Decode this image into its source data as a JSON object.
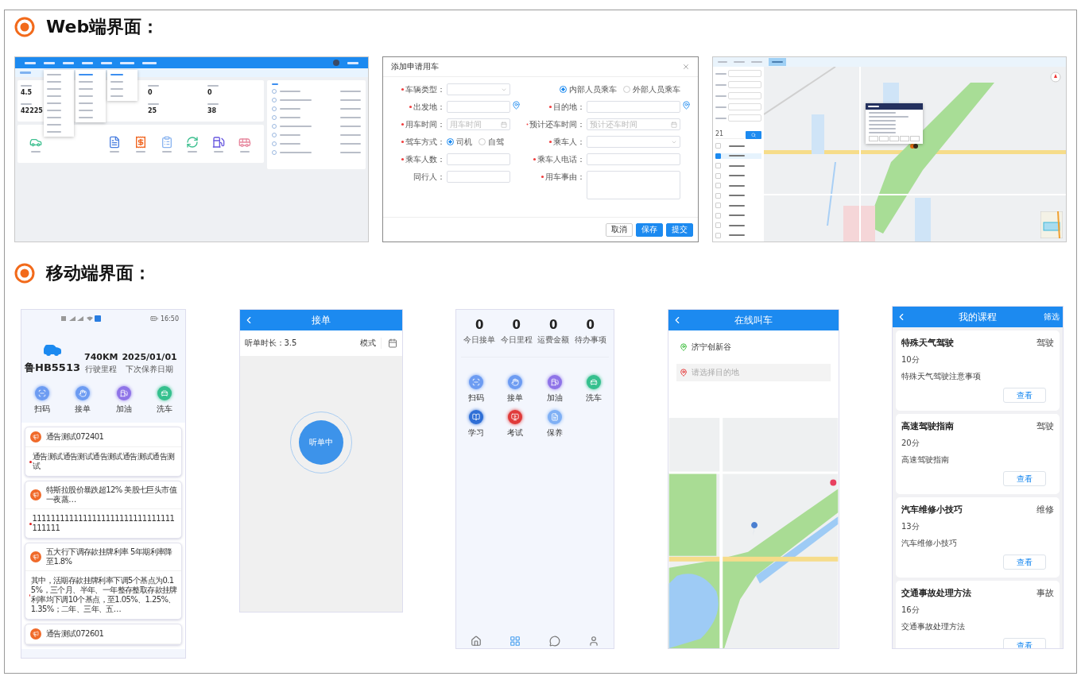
{
  "web_section": {
    "title": "Web端界面：",
    "dashboard": {
      "stats": [
        {
          "value": "4.5"
        },
        {
          "value": "0"
        },
        {
          "value": "0"
        },
        {
          "value": "42225"
        },
        {
          "value": "25"
        },
        {
          "value": "38"
        }
      ],
      "shortcuts": [
        {
          "kind": "car",
          "color": "#3cbf8f"
        },
        {
          "kind": "doc",
          "color": "#4a7fe0"
        },
        {
          "kind": "invoice",
          "color": "#f0641e"
        },
        {
          "kind": "clipboard",
          "color": "#8ab4f0"
        },
        {
          "kind": "refresh",
          "color": "#3cbf8f"
        },
        {
          "kind": "fuel",
          "color": "#6a5ae0"
        },
        {
          "kind": "bus",
          "color": "#e88aa0"
        }
      ]
    },
    "dialog": {
      "title": "添加申请用车",
      "fields": [
        {
          "kind": "select",
          "label": "车辆类型：",
          "required": true
        },
        {
          "kind": "radio",
          "options": [
            {
              "label": "内部人员乘车",
              "selected": true
            },
            {
              "label": "外部人员乘车",
              "selected": false
            }
          ]
        },
        {
          "kind": "location",
          "label": "出发地：",
          "required": true
        },
        {
          "kind": "location",
          "label": "目的地：",
          "required": true
        },
        {
          "kind": "date",
          "label": "用车时间：",
          "required": true,
          "placeholder": "用车时间"
        },
        {
          "kind": "date",
          "label": "预计还车时间：",
          "required": true,
          "placeholder": "预计还车时间"
        },
        {
          "kind": "radio",
          "label": "驾车方式：",
          "required": true,
          "options": [
            {
              "label": "司机",
              "selected": true
            },
            {
              "label": "自驾",
              "selected": false
            }
          ]
        },
        {
          "kind": "select",
          "label": "乘车人：",
          "required": true
        },
        {
          "kind": "text",
          "label": "乘车人数：",
          "required": true
        },
        {
          "kind": "text",
          "label": "乘车人电话：",
          "required": true
        },
        {
          "kind": "text",
          "label": "同行人：",
          "required": false
        },
        {
          "kind": "textarea",
          "label": "用车事由：",
          "required": true
        }
      ],
      "buttons": [
        {
          "label": "取消",
          "kind": "plain"
        },
        {
          "label": "保存",
          "kind": "primary"
        },
        {
          "label": "提交",
          "kind": "primary"
        }
      ]
    },
    "map_view": {
      "search_value": "21",
      "vehicles": [
        {
          "checked": false
        },
        {
          "checked": true
        },
        {
          "checked": false
        },
        {
          "checked": false
        },
        {
          "checked": false
        },
        {
          "checked": false
        },
        {
          "checked": false
        },
        {
          "checked": false
        },
        {
          "checked": false
        },
        {
          "checked": false
        }
      ]
    }
  },
  "mobile_section": {
    "title": "移动端界面：",
    "home": {
      "time": "16:50",
      "plate": "鲁HB5513",
      "stats": [
        {
          "value": "740KM",
          "label": "行驶里程"
        },
        {
          "value": "2025/01/01",
          "label": "下次保养日期"
        }
      ],
      "actions": [
        {
          "kind": "scan",
          "label": "扫码",
          "color": "#6d9cf2"
        },
        {
          "kind": "hand",
          "label": "接单",
          "color": "#6d9cf2"
        },
        {
          "kind": "fuel",
          "label": "加油",
          "color": "#8f74e8"
        },
        {
          "kind": "wash",
          "label": "洗车",
          "color": "#35c08e"
        }
      ],
      "notices": [
        {
          "title": "通告测试072401",
          "body": "通告测试通告测试通告测试通告测试通告测试"
        },
        {
          "title": "特斯拉股价暴跌超12% 美股七巨头市值一夜蒸…",
          "body": "1111111111111111111111111111111111111"
        },
        {
          "title": "五大行下调存款挂牌利率 5年期利率降至1.8%",
          "body": "其中，活期存款挂牌利率下调5个基点为0.15%，三个月、半年、一年整存整取存款挂牌利率均下调10个基点，至1.05%、1.25%、1.35%；二年、三年、五…"
        },
        {
          "title": "通告测试072601"
        }
      ]
    },
    "order": {
      "title": "接单",
      "duration": "听单时长：3.5",
      "mode": "模式",
      "button": "听单中"
    },
    "workbench": {
      "stats": [
        {
          "value": "0",
          "label": "今日接单"
        },
        {
          "value": "0",
          "label": "今日里程"
        },
        {
          "value": "0",
          "label": "运费金额"
        },
        {
          "value": "0",
          "label": "待办事项"
        }
      ],
      "actions": [
        {
          "kind": "scan",
          "label": "扫码",
          "color": "#6d9cf2"
        },
        {
          "kind": "hand",
          "label": "接单",
          "color": "#6d9cf2"
        },
        {
          "kind": "fuel",
          "label": "加油",
          "color": "#8f74e8"
        },
        {
          "kind": "wash",
          "label": "洗车",
          "color": "#35c08e"
        },
        {
          "kind": "book",
          "label": "学习",
          "color": "#2f6fd6"
        },
        {
          "kind": "exam",
          "label": "考试",
          "color": "#e03a3a"
        },
        {
          "kind": "doc",
          "label": "保养",
          "color": "#7fb0f5"
        }
      ],
      "tabs": [
        {
          "kind": "home",
          "selected": false
        },
        {
          "kind": "grid",
          "selected": true
        },
        {
          "kind": "chat",
          "selected": false
        },
        {
          "kind": "user",
          "selected": false
        }
      ]
    },
    "ride": {
      "title": "在线叫车",
      "origin": "济宁创新谷",
      "destination_placeholder": "请选择目的地"
    },
    "courses": {
      "title": "我的课程",
      "filter": "筛选",
      "items": [
        {
          "title": "特殊天气驾驶",
          "category": "驾驶",
          "duration": "10分",
          "description": "特殊天气驾驶注意事项",
          "action": "查看"
        },
        {
          "title": "高速驾驶指南",
          "category": "驾驶",
          "duration": "20分",
          "description": "高速驾驶指南",
          "action": "查看"
        },
        {
          "title": "汽车维修小技巧",
          "category": "维修",
          "duration": "13分",
          "description": "汽车维修小技巧",
          "action": "查看"
        },
        {
          "title": "交通事故处理方法",
          "category": "事故",
          "duration": "16分",
          "description": "交通事故处理方法",
          "action": "查看"
        }
      ]
    }
  }
}
